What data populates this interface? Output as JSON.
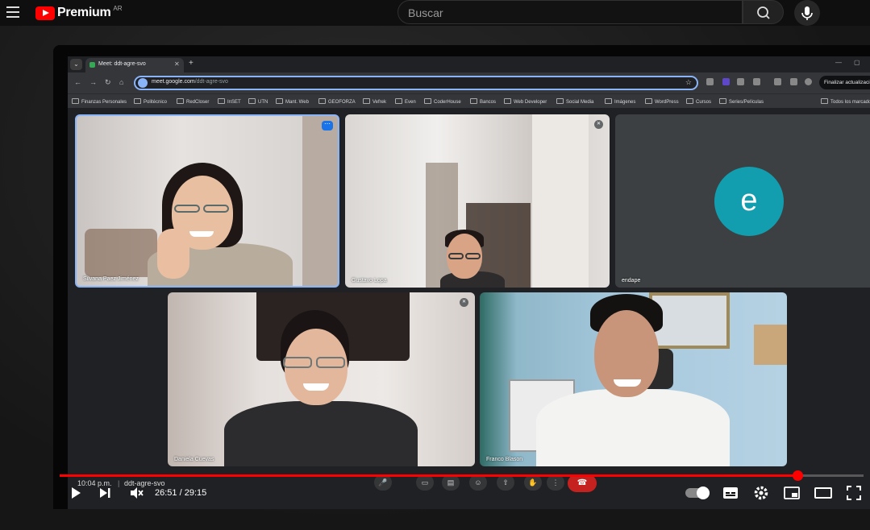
{
  "youtube": {
    "brand": "Premium",
    "region": "AR",
    "search_placeholder": "Buscar",
    "menu_icon": "hamburger-menu-icon",
    "search_icon": "search-icon",
    "mic_icon": "microphone-icon"
  },
  "browser": {
    "tab_title": "Meet: ddt-agre-svo",
    "url_host": "meet.google.com",
    "url_path": "/ddt-agre-svo",
    "update_button": "Finalizar actualización",
    "bookmarks": [
      "Finanzas Personales",
      "Politécnico",
      "RedCloser",
      "InSET",
      "UTN",
      "Mant. Web",
      "GEOFORZA",
      "Vefrek",
      "Even",
      "CoderHouse",
      "Bancos",
      "Web Developer",
      "Social Media",
      "Imágenes",
      "WordPress",
      "Cursos",
      "Series/Películas",
      "Todos los marcadores"
    ]
  },
  "meet": {
    "participants": [
      {
        "name": "Silvana Paez Jiménez",
        "muted": false,
        "pinned_menu": true
      },
      {
        "name": "Gustavo Lopa",
        "muted": true
      },
      {
        "name": "endape",
        "avatar_letter": "e",
        "avatar_color": "#129eaf"
      },
      {
        "name": "Daniela Cuevas",
        "muted": true
      },
      {
        "name": "Franco Blason",
        "muted": false
      }
    ],
    "overlay_time": "10:04 p.m.",
    "overlay_code": "ddt-agre-svo",
    "accent_hangup": "#c5221f"
  },
  "player": {
    "current_time": "26:51",
    "total_time": "29:15",
    "progress_fraction": 0.918,
    "progress_color": "#ff0000",
    "autoplay_on": true,
    "muted": true
  }
}
